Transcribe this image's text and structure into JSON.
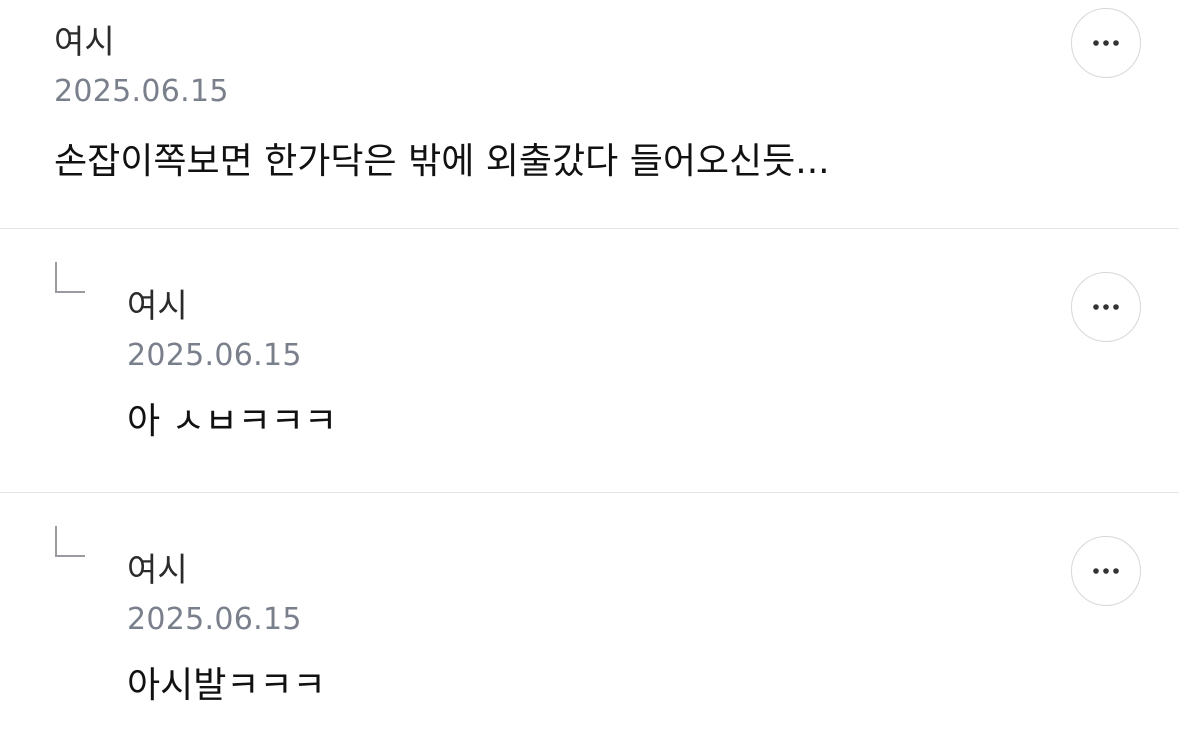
{
  "comments": [
    {
      "author": "여시",
      "date": "2025.06.15",
      "text": "손잡이쪽보면 한가닥은 밖에 외출갔다 들어오신듯...",
      "is_reply": false
    },
    {
      "author": "여시",
      "date": "2025.06.15",
      "text": "아 ㅅㅂㅋㅋㅋ",
      "is_reply": true
    },
    {
      "author": "여시",
      "date": "2025.06.15",
      "text": "아시발ㅋㅋㅋ",
      "is_reply": true
    }
  ],
  "icons": {
    "more": "more-horizontal-icon",
    "reply": "reply-arrow-icon"
  },
  "colors": {
    "date": "#7a7f8c",
    "divider": "#e4e4e7",
    "button_border": "#d7d7db"
  }
}
